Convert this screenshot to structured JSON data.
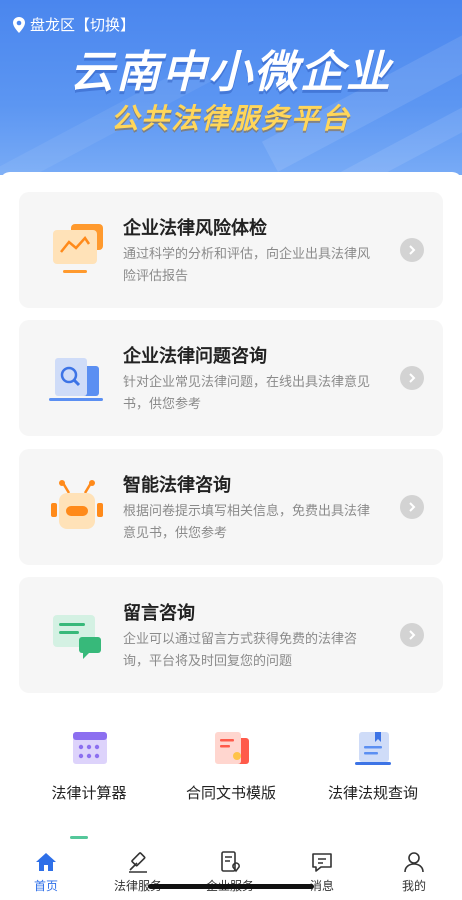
{
  "header": {
    "location": "盘龙区【切换】",
    "title": "云南中小微企业",
    "subtitle": "公共法律服务平台"
  },
  "cards": [
    {
      "title": "企业法律风险体检",
      "desc": "通过科学的分析和评估，向企业出具法律风险评估报告",
      "icon": "monitor-chart-icon"
    },
    {
      "title": "企业法律问题咨询",
      "desc": "针对企业常见法律问题，在线出具法律意见书，供您参考",
      "icon": "document-search-icon"
    },
    {
      "title": "智能法律咨询",
      "desc": "根据问卷提示填写相关信息，免费出具法律意见书，供您参考",
      "icon": "robot-icon"
    },
    {
      "title": "留言咨询",
      "desc": "企业可以通过留言方式获得免费的法律咨询，平台将及时回复您的问题",
      "icon": "message-icon"
    }
  ],
  "tools": [
    {
      "label": "法律计算器",
      "icon": "calculator-icon"
    },
    {
      "label": "合同文书模版",
      "icon": "contract-template-icon"
    },
    {
      "label": "法律法规查询",
      "icon": "law-book-icon"
    }
  ],
  "tabbar": {
    "active": "首页",
    "items": [
      {
        "label": "首页",
        "icon": "home-icon"
      },
      {
        "label": "法律服务",
        "icon": "gavel-icon"
      },
      {
        "label": "企业服务",
        "icon": "enterprise-service-icon"
      },
      {
        "label": "消息",
        "icon": "message-bubble-icon"
      },
      {
        "label": "我的",
        "icon": "profile-icon"
      }
    ]
  },
  "colors": {
    "banner_blue": "#4a86ee",
    "subtitle_yellow": "#ffd65a",
    "active_tab": "#2e6fe8",
    "card_bg": "#f6f6f6"
  }
}
